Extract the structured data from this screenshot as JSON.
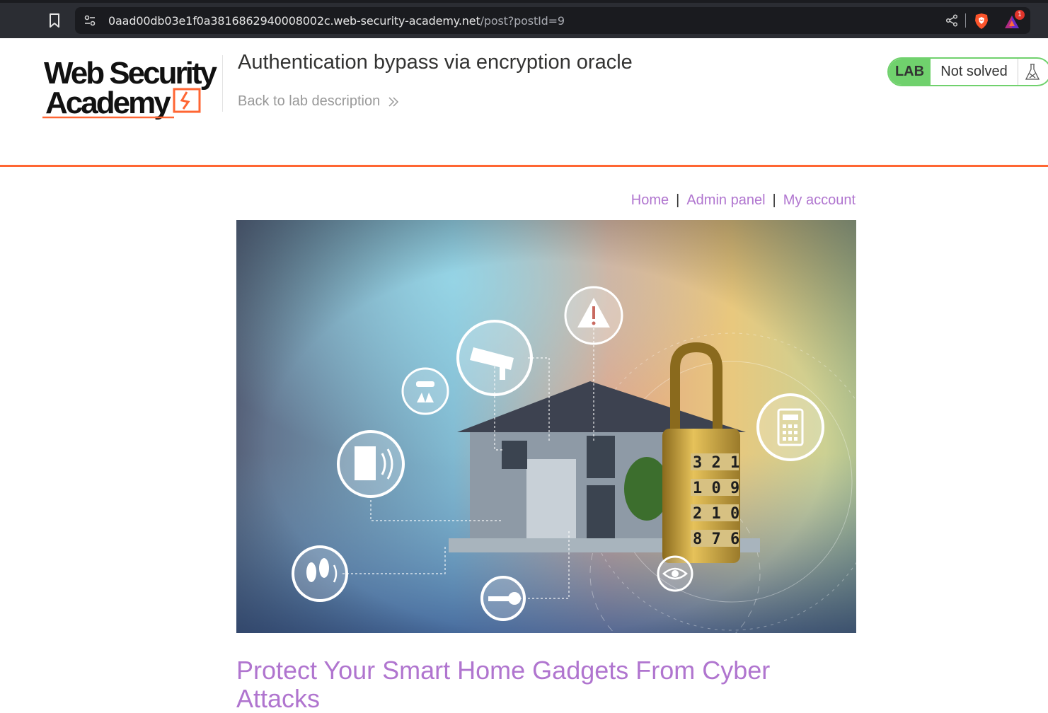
{
  "browser": {
    "url_host": "0aad00db03e1f0a3816862940008002c.web-security-academy.net",
    "url_path": "/post?postId=9",
    "rewards_badge_count": "1",
    "icons": [
      "bookmark-icon",
      "site-settings-icon",
      "share-icon",
      "brave-shield-icon",
      "brave-rewards-icon"
    ]
  },
  "lab": {
    "logo_line1": "Web Security",
    "logo_line2": "Academy",
    "title": "Authentication bypass via encryption oracle",
    "back_link": "Back to lab description",
    "badge": "LAB",
    "status": "Not solved",
    "colors": {
      "accent": "#ff6633",
      "solved_green": "#70d16d"
    }
  },
  "nav": {
    "home": "Home",
    "separator": "|",
    "admin_panel": "Admin panel",
    "my_account": "My account",
    "link_color": "#b075cf"
  },
  "hero": {
    "lock_digits": [
      "3 2 1",
      "1 0 9",
      "2 1 0",
      "8 7 6"
    ]
  },
  "post": {
    "title": "Protect Your Smart Home Gadgets From Cyber Attacks"
  }
}
